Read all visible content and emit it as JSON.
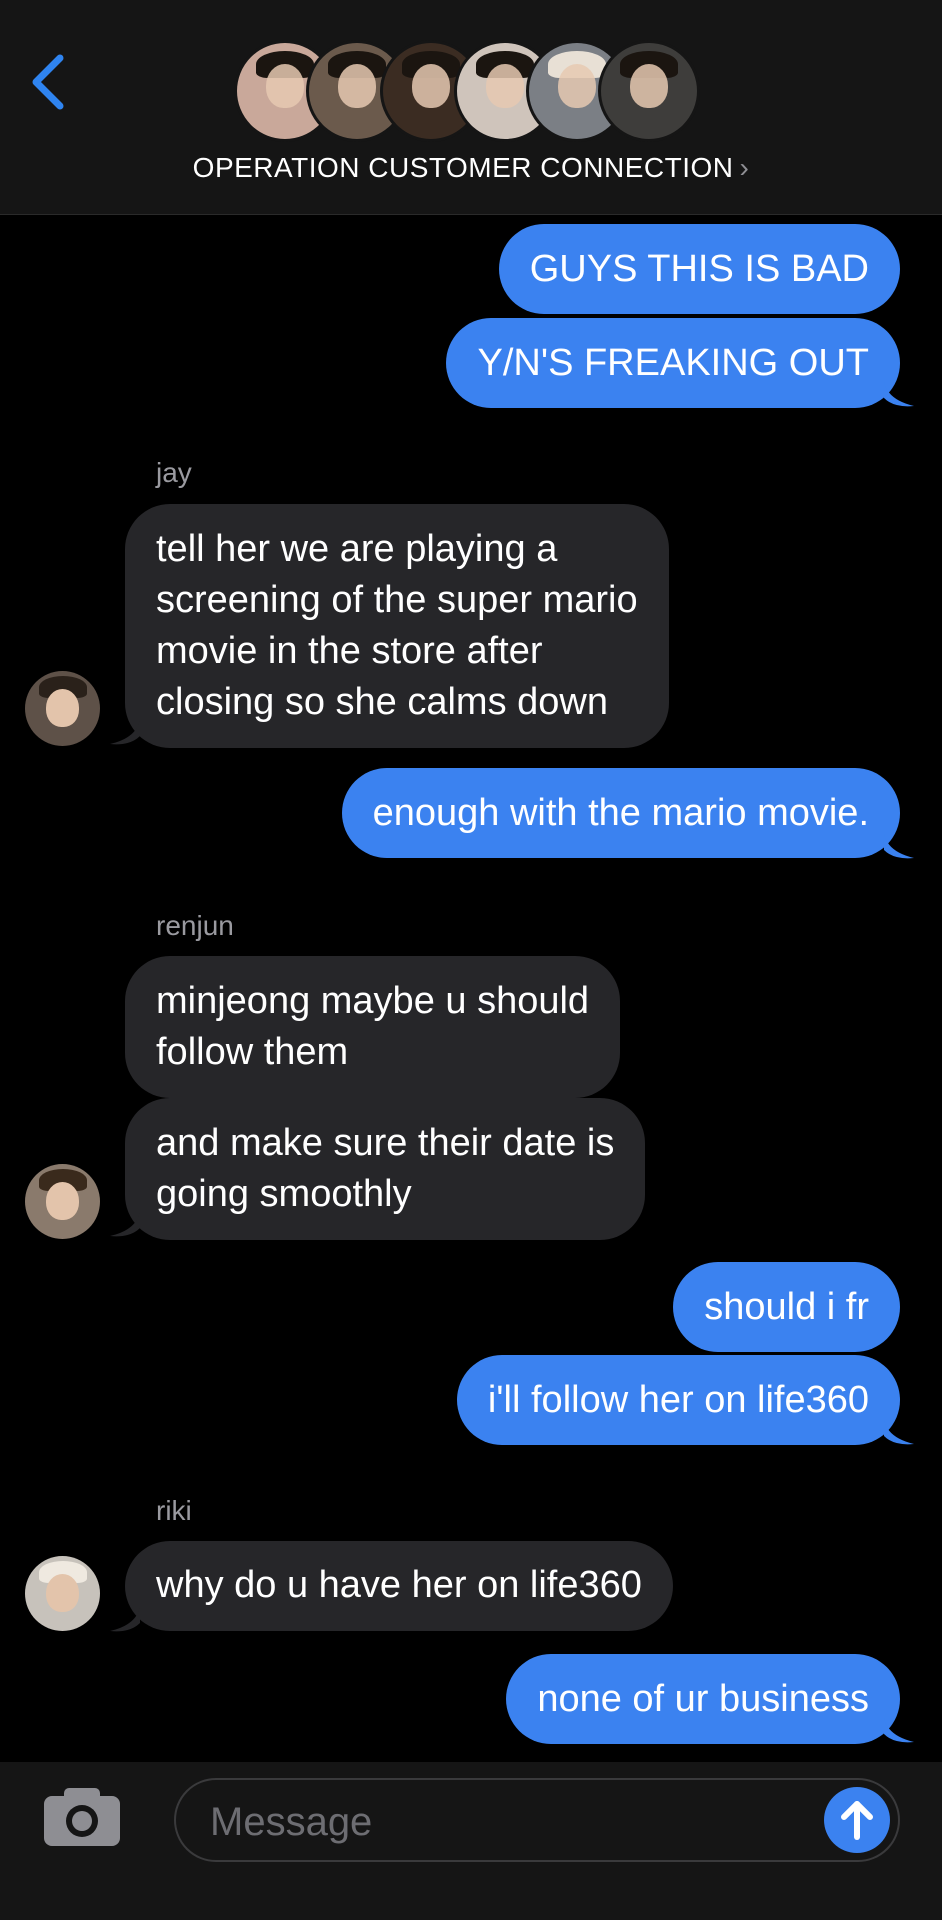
{
  "header": {
    "title": "OPERATION CUSTOMER CONNECTION",
    "chevron": "›",
    "avatar_colors": [
      "#c9a89a",
      "#6b5a4c",
      "#3b2c22",
      "#cfc4bb",
      "#7b7f85",
      "#3e3d3b"
    ]
  },
  "messages": [
    {
      "type": "sent",
      "text": "GUYS THIS IS BAD"
    },
    {
      "type": "sent",
      "text": "Y/N'S FREAKING OUT"
    },
    {
      "type": "name",
      "text": "jay"
    },
    {
      "type": "recv",
      "lines": [
        "tell her we are playing a",
        "screening of the super mario",
        "movie in the store after",
        "closing so she calms down"
      ]
    },
    {
      "type": "sent",
      "text": "enough with the mario movie."
    },
    {
      "type": "name",
      "text": "renjun"
    },
    {
      "type": "recv",
      "lines": [
        "minjeong maybe u should",
        "follow them"
      ]
    },
    {
      "type": "recv",
      "lines": [
        "and make sure their date is",
        "going smoothly"
      ]
    },
    {
      "type": "sent",
      "text": "should i fr"
    },
    {
      "type": "sent",
      "text": "i'll follow her on life360"
    },
    {
      "type": "name",
      "text": "riki"
    },
    {
      "type": "recv",
      "lines": [
        "why do u have her on life360"
      ]
    },
    {
      "type": "sent",
      "text": "none of ur business"
    }
  ],
  "composer": {
    "placeholder": "Message"
  },
  "colors": {
    "accent": "#3b82f0",
    "received_bubble": "#262629",
    "background": "#000000"
  }
}
